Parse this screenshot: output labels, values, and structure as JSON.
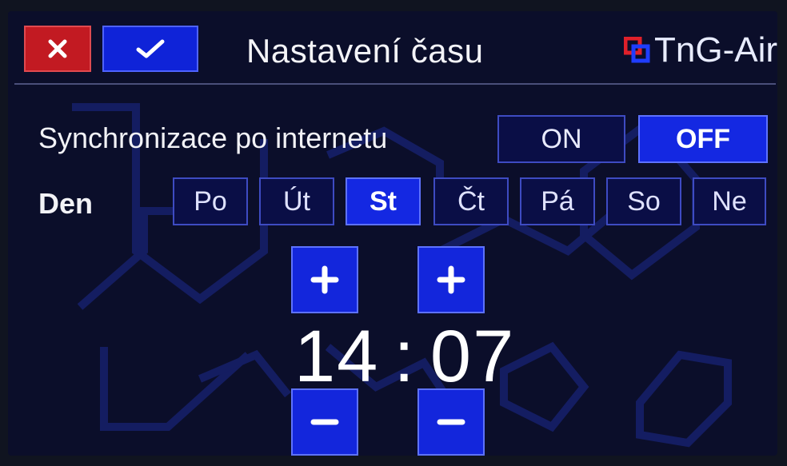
{
  "header": {
    "title": "Nastavení času",
    "brand": "TnG-Air",
    "cancel_icon": "close-icon",
    "confirm_icon": "check-icon"
  },
  "sync": {
    "label": "Synchronizace po internetu",
    "on_label": "ON",
    "off_label": "OFF",
    "selected": "OFF"
  },
  "day": {
    "label": "Den",
    "options": [
      "Po",
      "Út",
      "St",
      "Čt",
      "Pá",
      "So",
      "Ne"
    ],
    "selected": "St"
  },
  "time": {
    "hours": "14",
    "separator": ":",
    "minutes": "07"
  },
  "colors": {
    "accent_blue": "#1428e2",
    "cancel_red": "#c21a22",
    "background": "#0b0e2a"
  }
}
